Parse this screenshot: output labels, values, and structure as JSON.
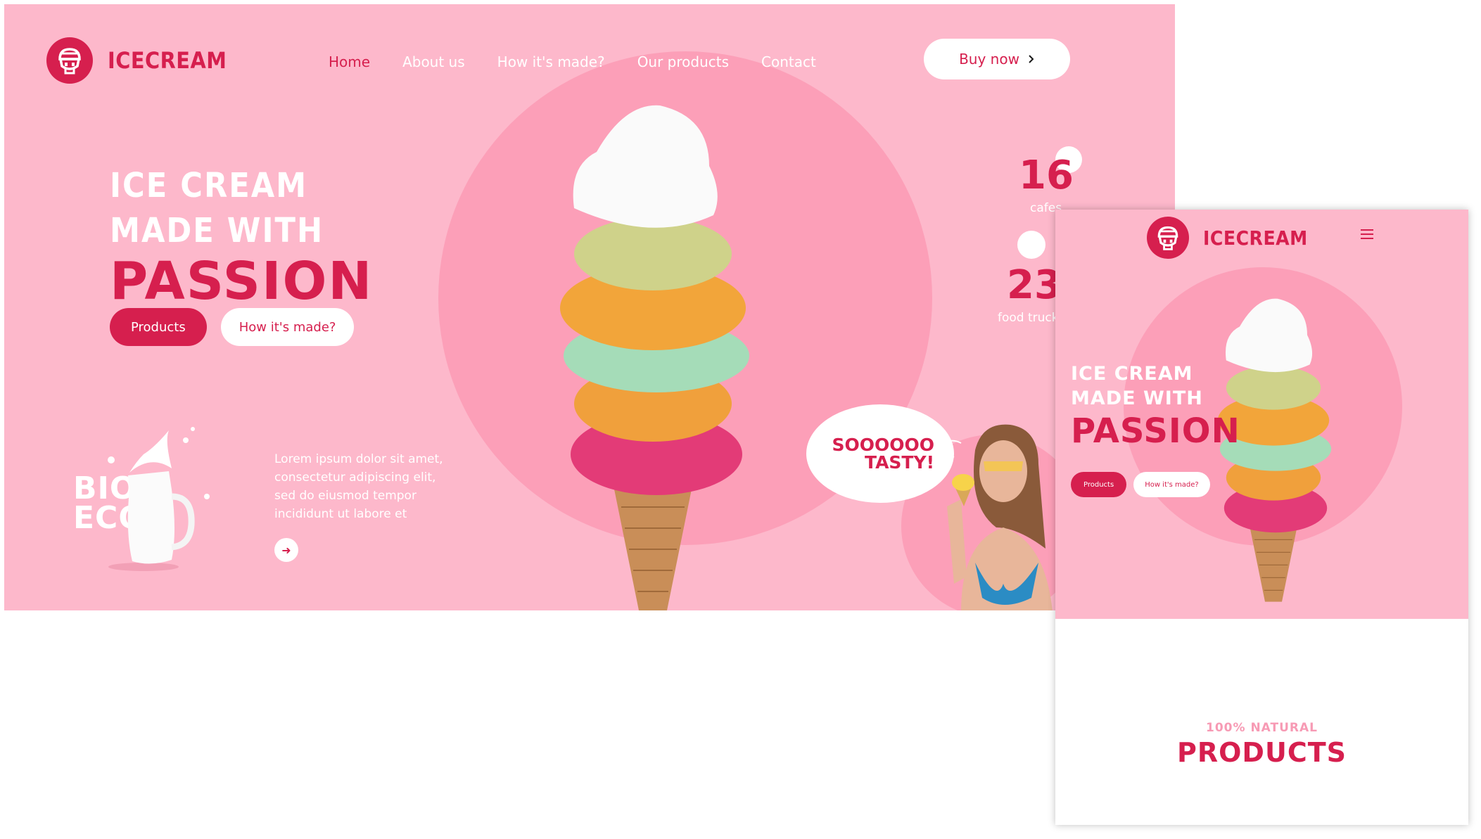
{
  "colors": {
    "brand": "#d61f4e",
    "background_pink": "#fdb8cb",
    "circle_pink": "#fc9fb8",
    "white": "#ffffff"
  },
  "desktop": {
    "logo": {
      "icon": "ice-cream-mascot-icon",
      "text": "ICECREAM"
    },
    "nav": {
      "items": [
        {
          "label": "Home",
          "active": true
        },
        {
          "label": "About us",
          "active": false
        },
        {
          "label": "How it's made?",
          "active": false
        },
        {
          "label": "Our products",
          "active": false
        },
        {
          "label": "Contact",
          "active": false
        }
      ]
    },
    "buy_button": {
      "label": "Buy now",
      "icon": "chevron-right-icon"
    },
    "hero": {
      "line1": "ICE CREAM",
      "line2": "MADE WITH",
      "accent": "PASSION",
      "primary_button": "Products",
      "secondary_button": "How it's made?"
    },
    "bio": {
      "line1": "BIO",
      "line2": "ECO"
    },
    "lorem": "Lorem ipsum dolor sit amet, consectetur adipiscing elit, sed do eiusmod tempor incididunt ut labore et",
    "arrow_icon": "arrow-right-icon",
    "stats": [
      {
        "value": "16",
        "label": "cafes"
      },
      {
        "value": "23",
        "label": "food truck"
      }
    ],
    "bubble": {
      "line1": "SOOOOOO",
      "line2": "TASTY!"
    }
  },
  "mobile": {
    "logo": {
      "icon": "ice-cream-mascot-icon",
      "text": "ICECREAM"
    },
    "menu_icon": "hamburger-menu-icon",
    "hero": {
      "line1": "ICE CREAM",
      "line2": "MADE WITH",
      "accent": "PASSION",
      "primary_button": "Products",
      "secondary_button": "How it's made?"
    },
    "section": {
      "eyebrow": "100% NATURAL",
      "title": "PRODUCTS"
    }
  }
}
